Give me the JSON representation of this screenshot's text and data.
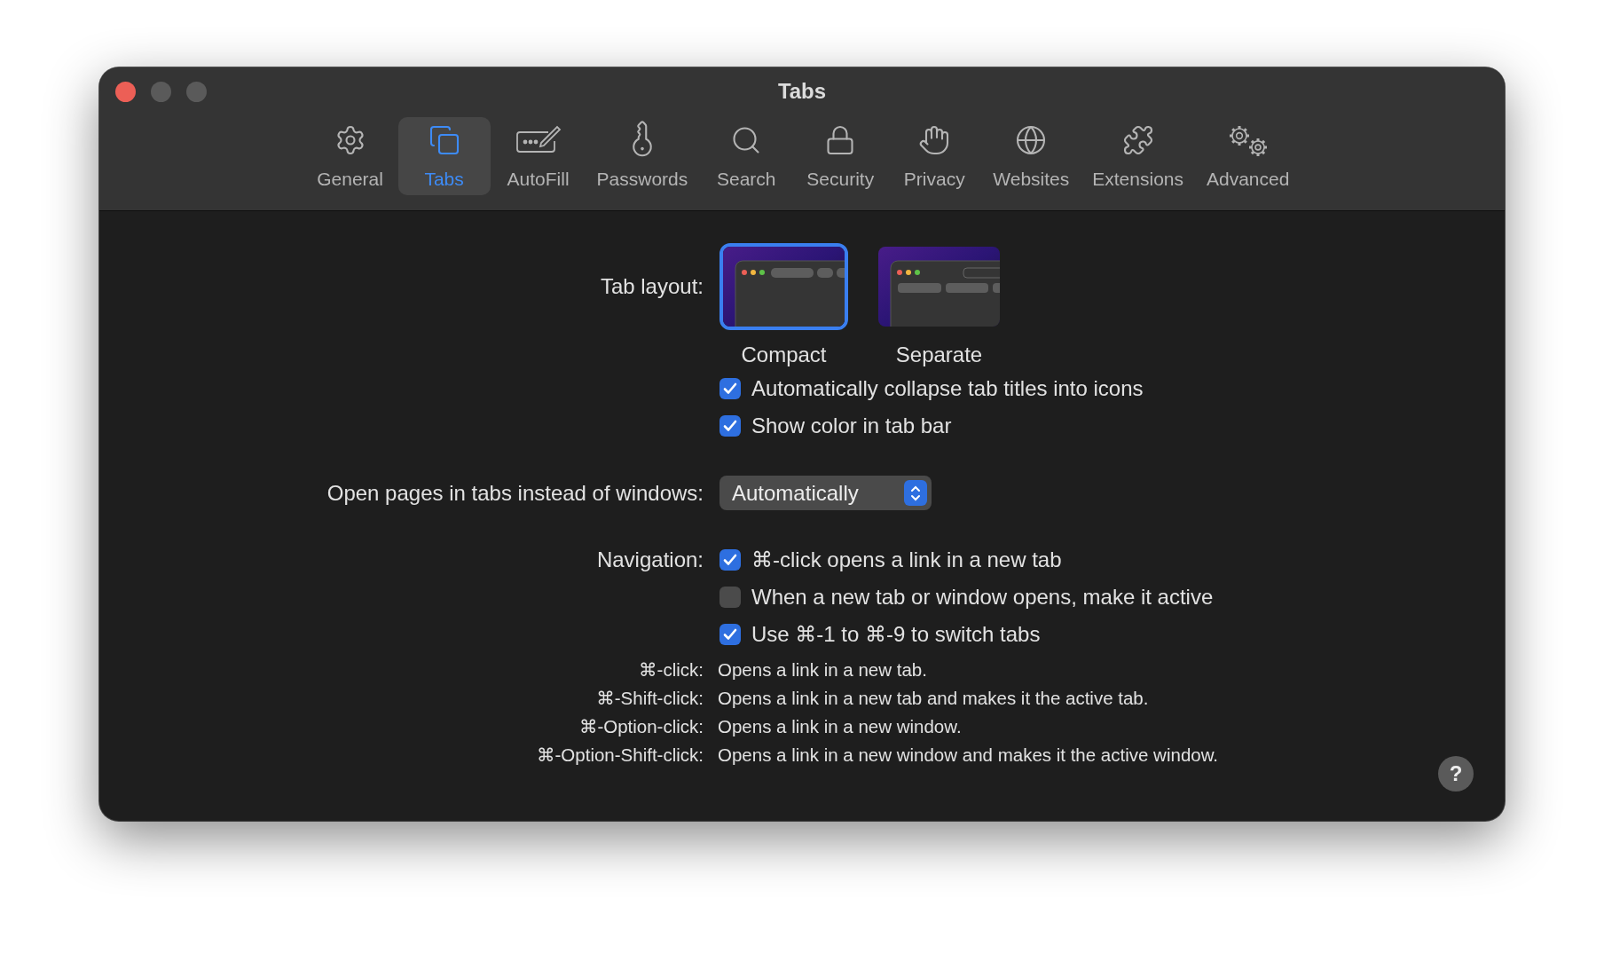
{
  "window": {
    "title": "Tabs"
  },
  "toolbar": [
    {
      "label": "General",
      "selected": false
    },
    {
      "label": "Tabs",
      "selected": true
    },
    {
      "label": "AutoFill",
      "selected": false
    },
    {
      "label": "Passwords",
      "selected": false
    },
    {
      "label": "Search",
      "selected": false
    },
    {
      "label": "Security",
      "selected": false
    },
    {
      "label": "Privacy",
      "selected": false
    },
    {
      "label": "Websites",
      "selected": false
    },
    {
      "label": "Extensions",
      "selected": false
    },
    {
      "label": "Advanced",
      "selected": false
    }
  ],
  "tab_layout": {
    "label": "Tab layout:",
    "options": [
      {
        "label": "Compact",
        "kind": "compact",
        "selected": true
      },
      {
        "label": "Separate",
        "kind": "separate",
        "selected": false
      }
    ]
  },
  "layout_checkboxes": [
    {
      "label": "Automatically collapse tab titles into icons",
      "checked": true
    },
    {
      "label": "Show color in tab bar",
      "checked": true
    }
  ],
  "open_pages": {
    "label": "Open pages in tabs instead of windows:",
    "value": "Automatically"
  },
  "navigation": {
    "label": "Navigation:",
    "options": [
      {
        "label": "⌘-click opens a link in a new tab",
        "checked": true
      },
      {
        "label": "When a new tab or window opens, make it active",
        "checked": false
      },
      {
        "label": "Use ⌘-1 to ⌘-9 to switch tabs",
        "checked": true
      }
    ]
  },
  "shortcuts": [
    {
      "key": "⌘-click:",
      "description": "Opens a link in a new tab."
    },
    {
      "key": "⌘-Shift-click:",
      "description": "Opens a link in a new tab and makes it the active tab."
    },
    {
      "key": "⌘-Option-click:",
      "description": "Opens a link in a new window."
    },
    {
      "key": "⌘-Option-Shift-click:",
      "description": "Opens a link in a new window and makes it the active window."
    }
  ],
  "help": {
    "label": "?"
  }
}
